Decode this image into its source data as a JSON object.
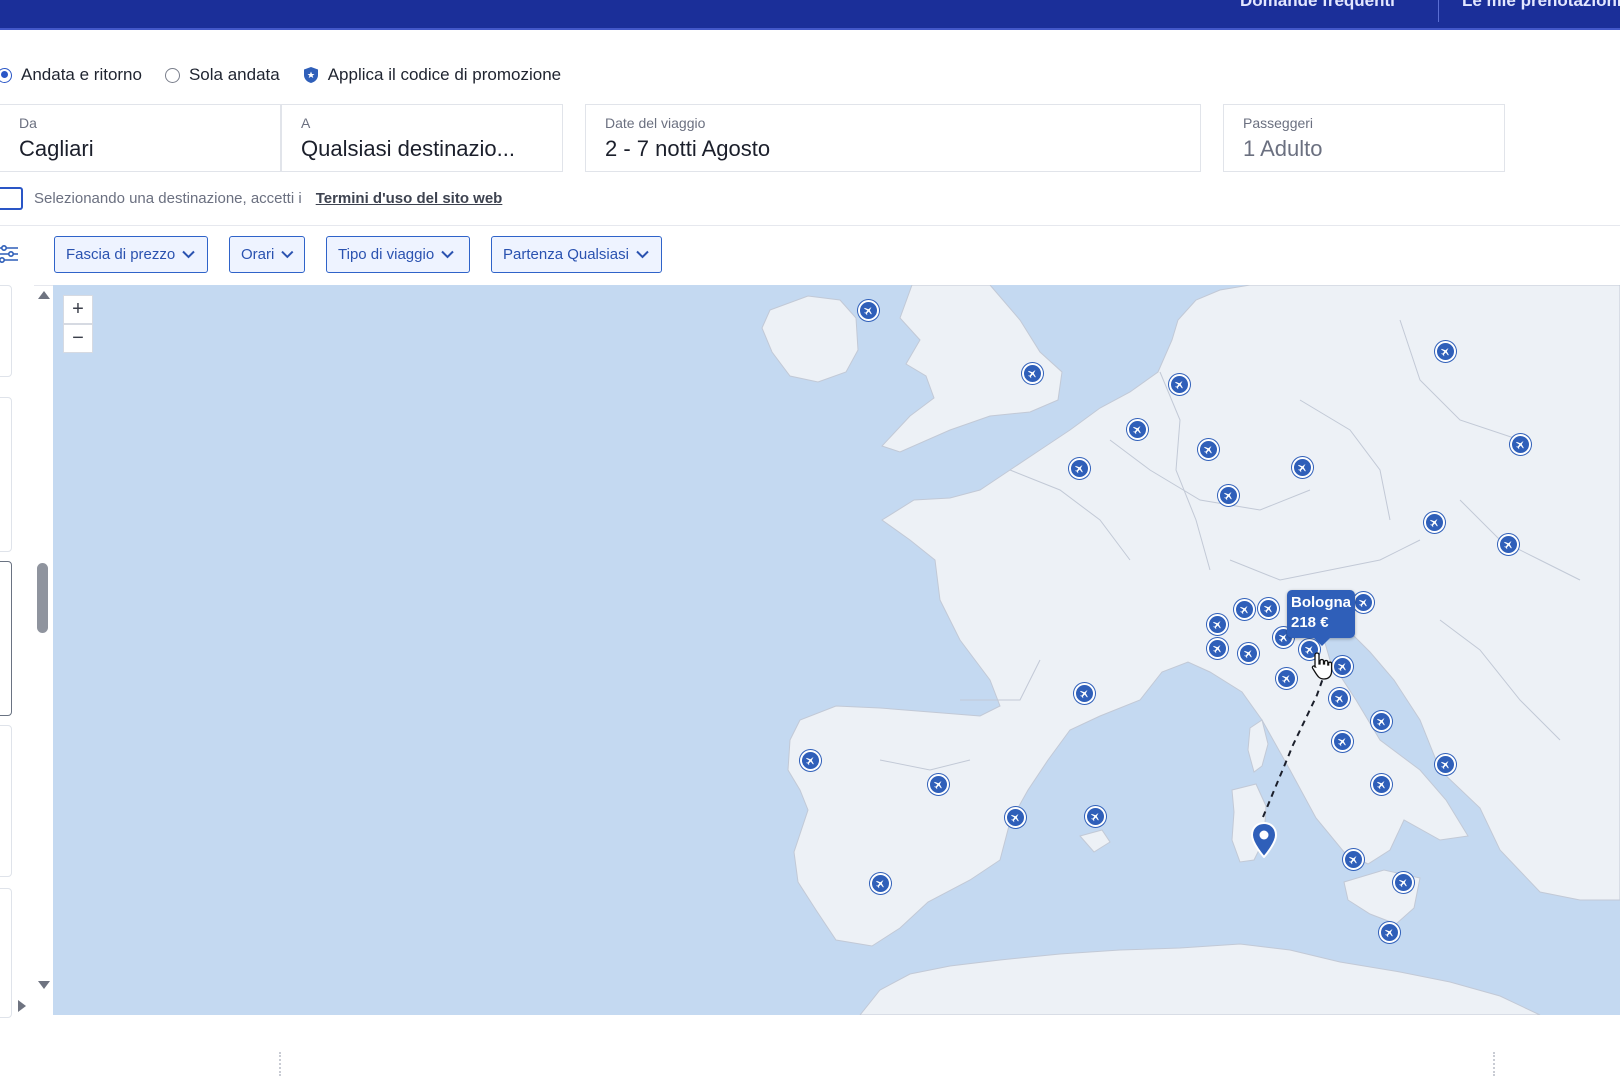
{
  "header": {
    "faq_label": "Domande frequenti",
    "bookings_label": "Le mie prenotazioni"
  },
  "trip_options": {
    "round_trip_label": "Andata e ritorno",
    "one_way_label": "Sola andata",
    "promo_label": "Applica il codice di promozione",
    "selected": "round_trip"
  },
  "search": {
    "from_label": "Da",
    "from_value": "Cagliari",
    "to_label": "A",
    "to_value": "Qualsiasi destinazio...",
    "dates_label": "Date del viaggio",
    "dates_value": "2 - 7 notti Agosto",
    "passengers_label": "Passeggeri",
    "passengers_value": "1 Adulto"
  },
  "terms": {
    "text": "Selezionando una destinazione, accetti i",
    "link": "Termini d'uso del sito web"
  },
  "filters": [
    {
      "label": "Fascia di prezzo"
    },
    {
      "label": "Orari"
    },
    {
      "label": "Tipo di viaggio"
    },
    {
      "label": "Partenza Qualsiasi"
    }
  ],
  "map": {
    "zoom_in": "+",
    "zoom_out": "−",
    "tooltip": {
      "city": "Bologna",
      "price": "218 €"
    },
    "colors": {
      "sea": "#c4d9f1",
      "land": "#edf1f6",
      "pin": "#2f5fb9",
      "brand": "#1b2f99"
    }
  },
  "icons": {
    "pin": "airplane-icon",
    "origin": "map-marker-icon",
    "promo": "shield-badge-icon",
    "filter": "sliders-icon",
    "cursor": "hand-pointer-icon"
  }
}
